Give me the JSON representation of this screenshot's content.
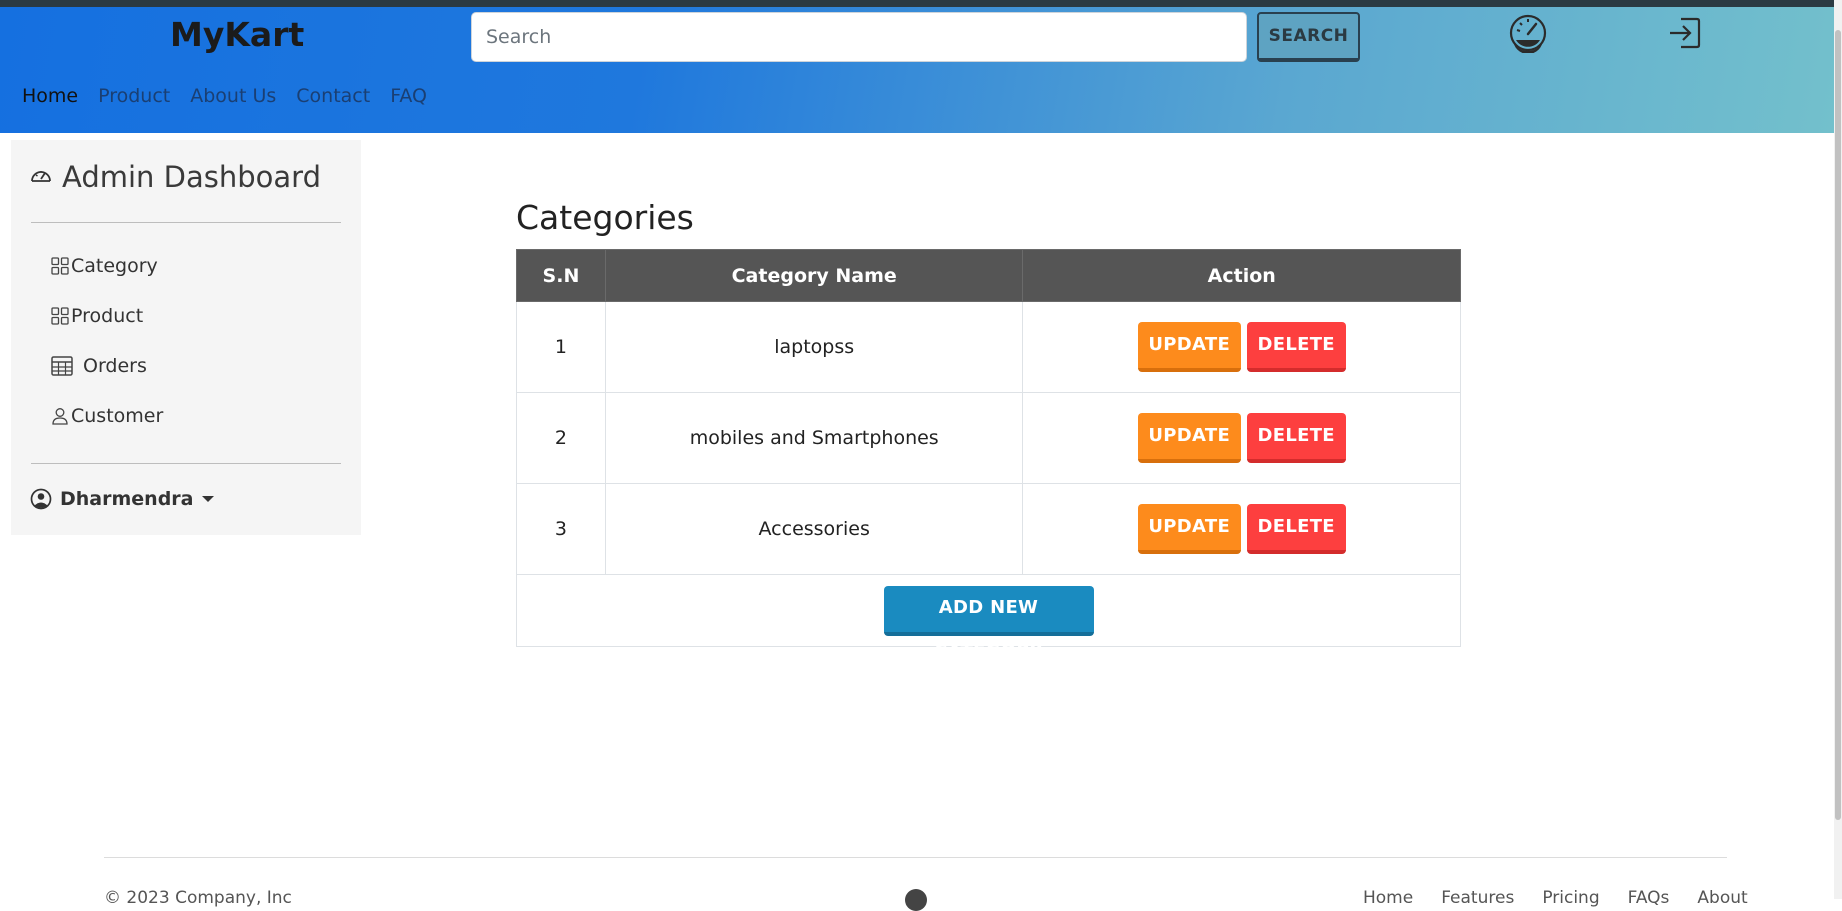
{
  "navbar": {
    "brand": "MyKart",
    "search_placeholder": "Search",
    "search_button": "SEARCH",
    "links": [
      "Home",
      "Product",
      "About Us",
      "Contact",
      "FAQ"
    ],
    "icons": [
      "dashboard-icon",
      "logout-icon"
    ]
  },
  "sidebar": {
    "title": "Admin Dashboard",
    "items": [
      {
        "label": "Category",
        "icon": "grid-icon"
      },
      {
        "label": "Product",
        "icon": "grid-icon"
      },
      {
        "label": "Orders",
        "icon": "table-icon"
      },
      {
        "label": "Customer",
        "icon": "person-icon"
      }
    ],
    "user": "Dharmendra"
  },
  "main": {
    "title": "Categories",
    "headers": [
      "S.N",
      "Category Name",
      "Action"
    ],
    "rows": [
      {
        "sn": "1",
        "name": "laptopss"
      },
      {
        "sn": "2",
        "name": "mobiles and Smartphones"
      },
      {
        "sn": "3",
        "name": "Accessories"
      }
    ],
    "update_label": "UPDATE",
    "delete_label": "DELETE",
    "add_label": "ADD NEW CATEGORY"
  },
  "footer": {
    "copyright": "© 2023 Company, Inc",
    "links": [
      "Home",
      "Features",
      "Pricing",
      "FAQs",
      "About"
    ]
  },
  "colors": {
    "navbar_start": "#1570e0",
    "navbar_end": "#73c0cc",
    "update": "#fd8b1c",
    "delete": "#fd3f3f",
    "add": "#1a8bc0",
    "table_header": "#555555"
  }
}
